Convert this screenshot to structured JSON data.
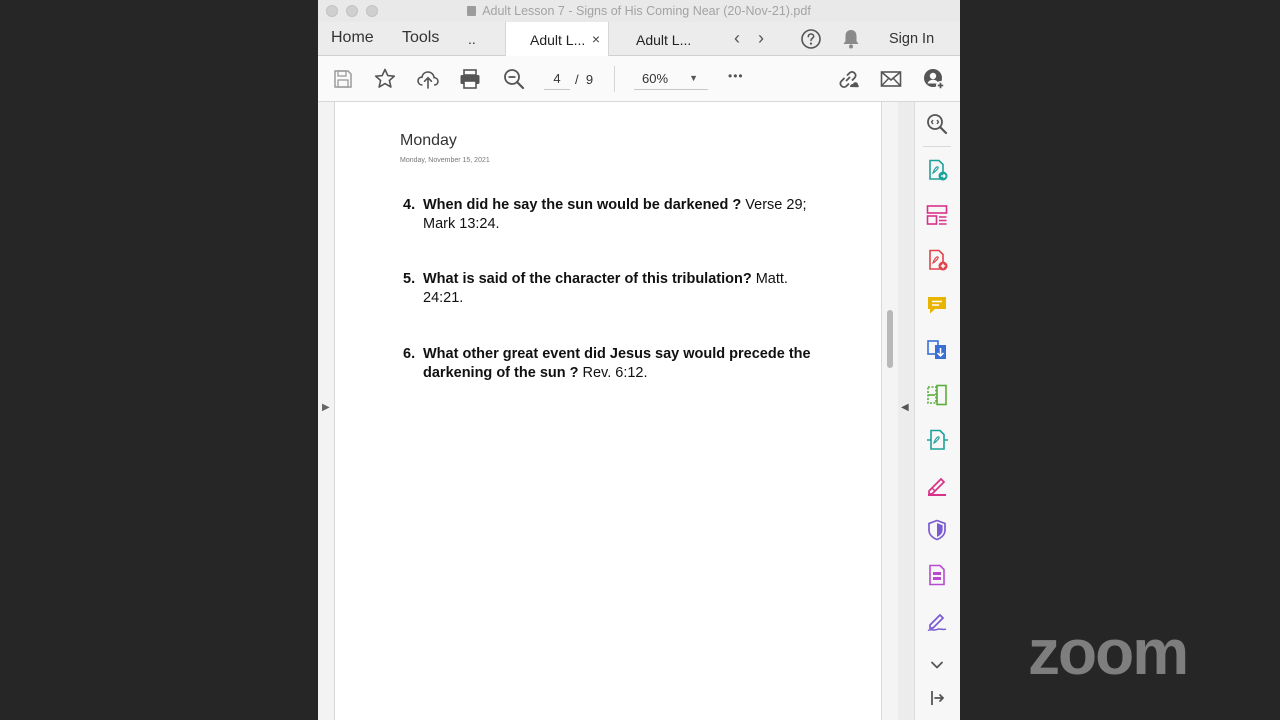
{
  "window": {
    "title": "Adult Lesson 7 - Signs of His Coming Near (20-Nov-21).pdf"
  },
  "tabbar": {
    "home_label": "Home",
    "tools_label": "Tools",
    "more_label": "..",
    "tabs": [
      {
        "label": "Adult L...",
        "active": true,
        "close": "×"
      },
      {
        "label": "Adult L...",
        "active": false
      }
    ],
    "prev_symbol": "‹",
    "next_symbol": "›",
    "sign_in_label": "Sign In"
  },
  "toolbar": {
    "current_page": "4",
    "page_separator": "/",
    "total_pages": "9",
    "zoom_level": "60%",
    "zoom_caret": "▼",
    "more_symbol": "•••"
  },
  "document": {
    "heading": "Monday",
    "date": "Monday, November 15, 2021",
    "questions": [
      {
        "number": "4.",
        "question": "When did he say the sun would be darkened ?",
        "reference": " Verse 29; Mark 13:24."
      },
      {
        "number": "5.",
        "question": "What is said of the character of this tribulation?",
        "reference": " Matt. 24:21."
      },
      {
        "number": "6.",
        "question": "What other great event did Jesus say would precede the darkening of the sun ?",
        "reference": " Rev. 6:12."
      }
    ]
  },
  "side_arrows": {
    "left": "▶",
    "right": "◀"
  },
  "colors": {
    "accent_teal": "#1fa09a",
    "accent_pink": "#d9318a",
    "accent_red": "#e0434a",
    "accent_yellow": "#e8b400",
    "accent_blue": "#3b6fd6",
    "accent_green": "#5aae3c",
    "accent_purple": "#7a5bd1",
    "accent_magenta": "#b94ad0"
  },
  "overlay": {
    "brand": "zoom"
  }
}
